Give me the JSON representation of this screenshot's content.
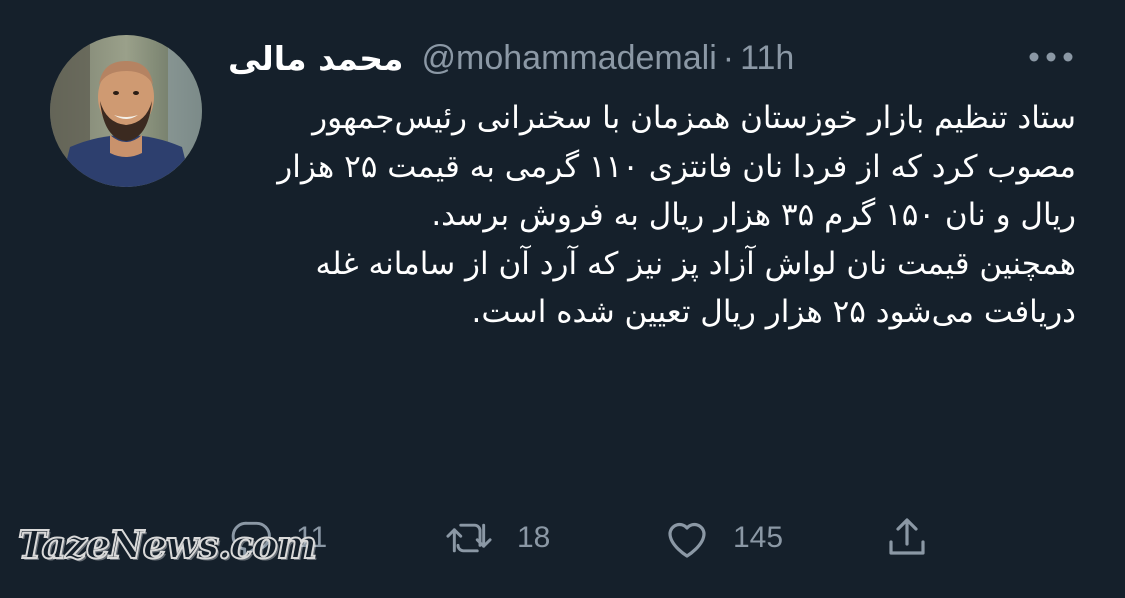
{
  "tweet": {
    "display_name": "محمد مالی",
    "handle": "@mohammademali",
    "separator": "·",
    "time": "11h",
    "paragraphs": [
      "ستاد تنظیم بازار خوزستان همزمان با سخنرانی رئیس‌جمهور مصوب کرد که از فردا نان فانتزی ۱۱۰ گرمی به قیمت ۲۵ هزار ریال و نان ۱۵۰ گرم ۳۵ هزار ریال به فروش برسد.",
      "همچنین قیمت نان لواش آزاد پز نیز که آرد آن از سامانه غله دریافت می‌شود  ۲۵ هزار ریال تعیین شده است."
    ]
  },
  "actions": {
    "reply_count": "11",
    "retweet_count": "18",
    "like_count": "145"
  },
  "watermark": {
    "text": "TazeNews.com"
  },
  "colors": {
    "background": "#15202b",
    "secondary_text": "#8b98a5",
    "primary_text": "#ffffff"
  }
}
